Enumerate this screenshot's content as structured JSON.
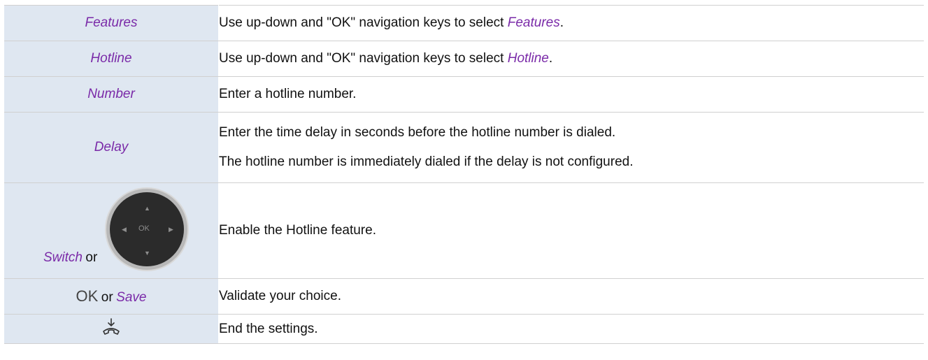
{
  "rows": [
    {
      "key": "Features",
      "desc_pre": "Use up-down and \"OK\" navigation keys to select ",
      "desc_term": "Features",
      "desc_post": "."
    },
    {
      "key": "Hotline",
      "desc_pre": "Use up-down and \"OK\" navigation keys to select ",
      "desc_term": "Hotline",
      "desc_post": "."
    },
    {
      "key": "Number",
      "desc": "Enter a hotline number."
    },
    {
      "key": "Delay",
      "desc_line1": "Enter the time delay in seconds before the hotline number is dialed.",
      "desc_line2": "The hotline number is immediately dialed if the delay is not configured."
    },
    {
      "key_term": "Switch",
      "key_or": "or",
      "desc": "Enable the Hotline feature.",
      "navpad": {
        "ok": "OK",
        "up": "▲",
        "down": "▼",
        "left": "◀",
        "right": "▶"
      }
    },
    {
      "key_ok": "OK",
      "key_or": "or",
      "key_term": "Save",
      "desc": "Validate your choice."
    },
    {
      "key_icon": "hang-up-icon",
      "desc": "End the settings."
    }
  ],
  "colors": {
    "menu_term": "#7a2aa8",
    "key_bg": "#dfe7f1",
    "border": "#d0d0d0"
  }
}
